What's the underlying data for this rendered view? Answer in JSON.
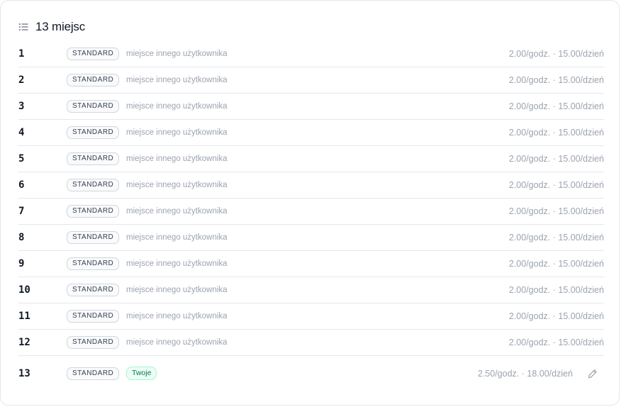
{
  "header": {
    "title": "13 miejsc",
    "icon": "list-icon"
  },
  "spots": [
    {
      "number": "1",
      "type": "STANDARD",
      "owner": "miejsce innego użytkownika",
      "price": "2.00/godz. · 15.00/dzień"
    },
    {
      "number": "2",
      "type": "STANDARD",
      "owner": "miejsce innego użytkownika",
      "price": "2.00/godz. · 15.00/dzień"
    },
    {
      "number": "3",
      "type": "STANDARD",
      "owner": "miejsce innego użytkownika",
      "price": "2.00/godz. · 15.00/dzień"
    },
    {
      "number": "4",
      "type": "STANDARD",
      "owner": "miejsce innego użytkownika",
      "price": "2.00/godz. · 15.00/dzień"
    },
    {
      "number": "5",
      "type": "STANDARD",
      "owner": "miejsce innego użytkownika",
      "price": "2.00/godz. · 15.00/dzień"
    },
    {
      "number": "6",
      "type": "STANDARD",
      "owner": "miejsce innego użytkownika",
      "price": "2.00/godz. · 15.00/dzień"
    },
    {
      "number": "7",
      "type": "STANDARD",
      "owner": "miejsce innego użytkownika",
      "price": "2.00/godz. · 15.00/dzień"
    },
    {
      "number": "8",
      "type": "STANDARD",
      "owner": "miejsce innego użytkownika",
      "price": "2.00/godz. · 15.00/dzień"
    },
    {
      "number": "9",
      "type": "STANDARD",
      "owner": "miejsce innego użytkownika",
      "price": "2.00/godz. · 15.00/dzień"
    },
    {
      "number": "10",
      "type": "STANDARD",
      "owner": "miejsce innego użytkownika",
      "price": "2.00/godz. · 15.00/dzień"
    },
    {
      "number": "11",
      "type": "STANDARD",
      "owner": "miejsce innego użytkownika",
      "price": "2.00/godz. · 15.00/dzień"
    },
    {
      "number": "12",
      "type": "STANDARD",
      "owner": "miejsce innego użytkownika",
      "price": "2.00/godz. · 15.00/dzień"
    },
    {
      "number": "13",
      "type": "STANDARD",
      "badge": "Twoje",
      "price": "2.50/godz. · 18.00/dzień",
      "edit_icon": "pencil-icon"
    }
  ],
  "colors": {
    "own_badge_bg": "#ecfdf5",
    "own_badge_text": "#047857",
    "muted_text": "#9ca3af"
  }
}
